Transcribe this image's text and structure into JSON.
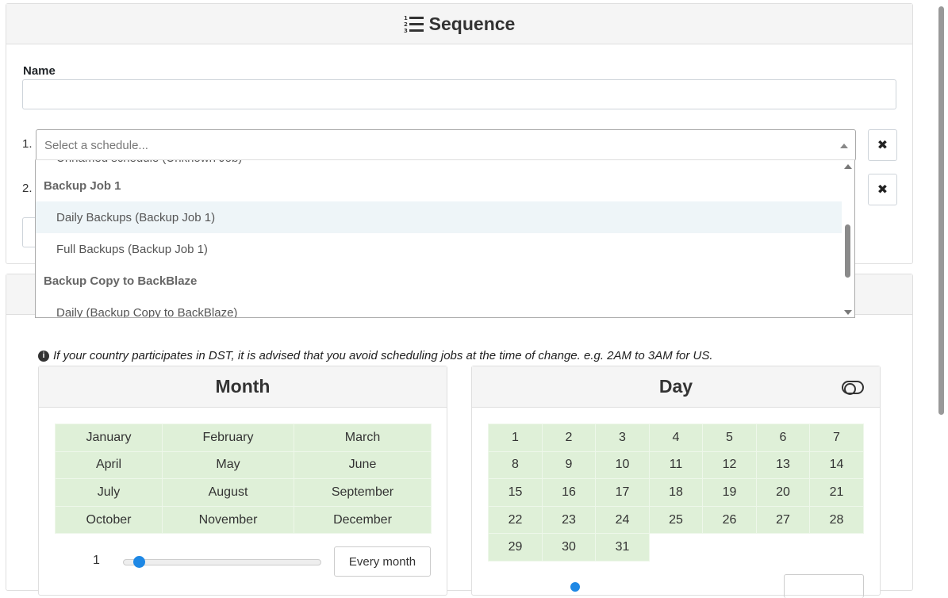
{
  "sequence": {
    "title": "Sequence",
    "name_label": "Name",
    "name_value": "",
    "rows": [
      {
        "num": "1.",
        "placeholder": "Select a schedule..."
      },
      {
        "num": "2."
      }
    ],
    "remove_icon": "times-icon"
  },
  "dropdown": {
    "partial_top": "Unnamed schedule (Unknown Job)",
    "groups": [
      {
        "label": "Backup Job 1",
        "options": [
          "Daily Backups (Backup Job 1)",
          "Full Backups (Backup Job 1)"
        ]
      },
      {
        "label": "Backup Copy to BackBlaze",
        "options": [
          "Daily (Backup Copy to BackBlaze)"
        ]
      }
    ],
    "highlighted_option": "Daily Backups (Backup Job 1)"
  },
  "schedule": {
    "dst_note": "If your country participates in DST, it is advised that you avoid scheduling jobs at the time of change. e.g. 2AM to 3AM for US.",
    "month": {
      "title": "Month",
      "months": [
        [
          "January",
          "February",
          "March"
        ],
        [
          "April",
          "May",
          "June"
        ],
        [
          "July",
          "August",
          "September"
        ],
        [
          "October",
          "November",
          "December"
        ]
      ],
      "slider_value": "1",
      "slider_fraction": 0.0,
      "every_button": "Every month"
    },
    "day": {
      "title": "Day",
      "days": [
        [
          "1",
          "2",
          "3",
          "4",
          "5",
          "6",
          "7"
        ],
        [
          "8",
          "9",
          "10",
          "11",
          "12",
          "13",
          "14"
        ],
        [
          "15",
          "16",
          "17",
          "18",
          "19",
          "20",
          "21"
        ],
        [
          "22",
          "23",
          "24",
          "25",
          "26",
          "27",
          "28"
        ],
        [
          "29",
          "30",
          "31"
        ]
      ]
    }
  },
  "colors": {
    "selected_cell": "#dff0d8",
    "accent": "#1e88e5",
    "highlight": "#eef5f8"
  }
}
